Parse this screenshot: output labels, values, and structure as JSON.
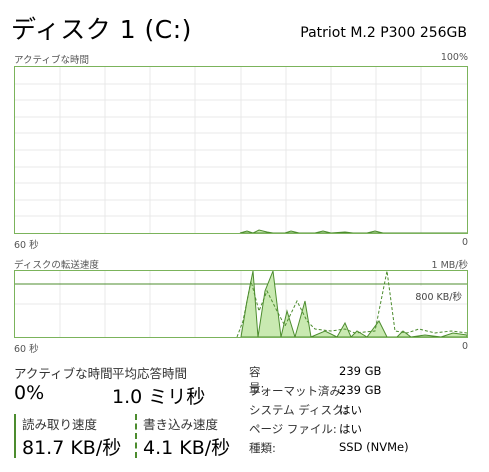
{
  "header": {
    "title": "ディスク 1 (C:)",
    "model": "Patriot M.2 P300 256GB"
  },
  "active_graph": {
    "label": "アクティブな時間",
    "max_label": "100%",
    "time_label": "60 秒",
    "min_label": "0"
  },
  "transfer_graph": {
    "label": "ディスクの転送速度",
    "max_label": "1 MB/秒",
    "ref_label": "800 KB/秒",
    "time_label": "60 秒",
    "min_label": "0"
  },
  "stats": {
    "active_time_label": "アクティブな時間",
    "active_time_value": "0%",
    "avg_response_label": "平均応答時間",
    "avg_response_value": "1.0 ミリ秒",
    "read_label": "読み取り速度",
    "read_value": "81.7 KB/秒",
    "write_label": "書き込み速度",
    "write_value": "4.1 KB/秒"
  },
  "properties": [
    {
      "key": "容量:",
      "value": "239 GB"
    },
    {
      "key": "フォーマット済み:",
      "value": "239 GB"
    },
    {
      "key": "システム ディスク:",
      "value": "はい"
    },
    {
      "key": "ページ ファイル:",
      "value": "はい"
    },
    {
      "key": "種類:",
      "value": "SSD (NVMe)"
    }
  ],
  "colors": {
    "accent": "#4c8c2e",
    "fill": "#c9e9b1",
    "grid": "#e8e8e8",
    "border": "#7bb35b"
  }
}
